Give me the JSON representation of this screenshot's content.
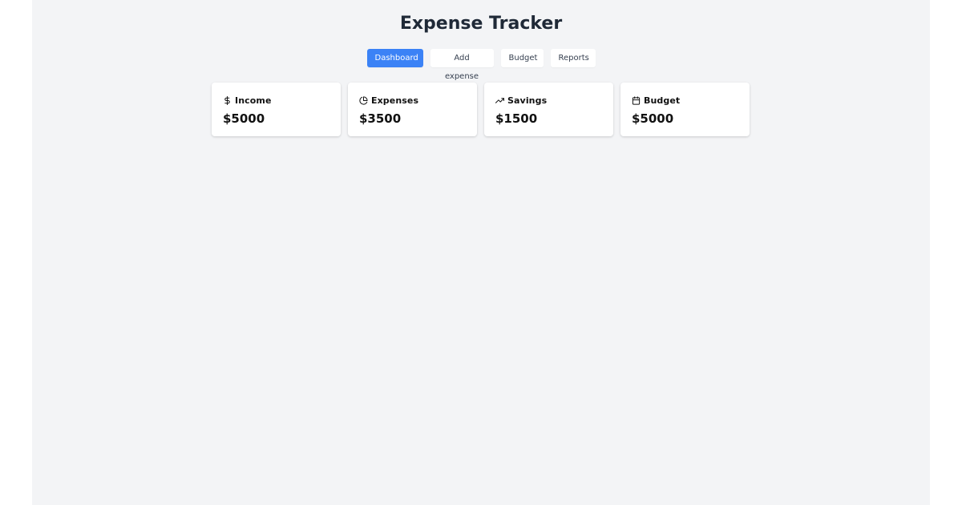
{
  "header": {
    "title": "Expense Tracker"
  },
  "nav": {
    "items": [
      {
        "label": "Dashboard",
        "active": true
      },
      {
        "label": "Add expense",
        "active": false
      },
      {
        "label": "Budget",
        "active": false
      },
      {
        "label": "Reports",
        "active": false
      }
    ]
  },
  "summary_cards": [
    {
      "label": "Income",
      "value": "$5000",
      "icon": "dollar-icon"
    },
    {
      "label": "Expenses",
      "value": "$3500",
      "icon": "pie-chart-icon"
    },
    {
      "label": "Savings",
      "value": "$1500",
      "icon": "trending-up-icon"
    },
    {
      "label": "Budget",
      "value": "$5000",
      "icon": "calendar-icon"
    }
  ],
  "colors": {
    "accent": "#3b82f6",
    "background": "#f3f4f6",
    "title": "#1f2937"
  }
}
